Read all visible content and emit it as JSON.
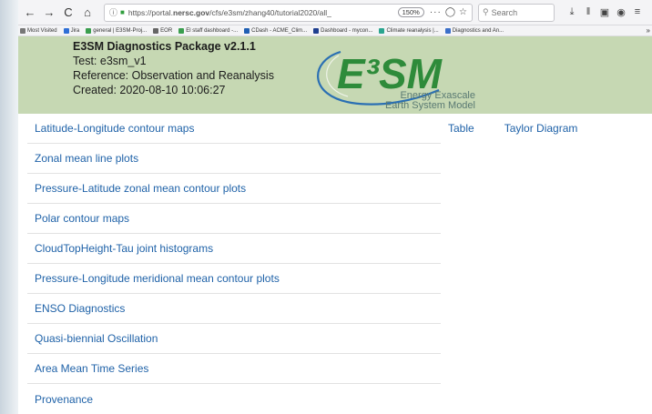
{
  "browser": {
    "nav": {
      "back": "←",
      "forward": "→",
      "reload": "C",
      "home": "⌂"
    },
    "url_prefix": "https://portal.",
    "url_domain": "nersc.gov",
    "url_path": "/cfs/e3sm/zhang40/tutorial2020/all_",
    "zoom": "150%",
    "page_actions": "···",
    "search_placeholder": "Search",
    "bookmarks": [
      {
        "label": "Most Visited",
        "color": "#777777"
      },
      {
        "label": "Jira",
        "color": "#2f6fd6"
      },
      {
        "label": "general | E3SM-Proj...",
        "color": "#3a9e4e"
      },
      {
        "label": "EOR",
        "color": "#666666"
      },
      {
        "label": "El staff dashboard -...",
        "color": "#3a9e4e"
      },
      {
        "label": "CDash - ACME_Clim...",
        "color": "#1f5fb3"
      },
      {
        "label": "Dashboard - mycon...",
        "color": "#1f3f8f"
      },
      {
        "label": "Climate reanalysis |...",
        "color": "#2aa58f"
      },
      {
        "label": "Diagnostics and An...",
        "color": "#3b6fc9"
      }
    ],
    "bookmarks_more": "»"
  },
  "header": {
    "title": "E3SM Diagnostics Package v2.1.1",
    "test": "Test: e3sm_v1",
    "reference": "Reference: Observation and Reanalysis",
    "created": "Created: 2020-08-10 10:06:27",
    "logo_text": "E³SM",
    "logo_sub1": "Energy Exascale",
    "logo_sub2": "Earth System Model"
  },
  "menu": [
    "Latitude-Longitude contour maps",
    "Zonal mean line plots",
    "Pressure-Latitude zonal mean contour plots",
    "Polar contour maps",
    "CloudTopHeight-Tau joint histograms",
    "Pressure-Longitude meridional mean contour plots",
    "ENSO Diagnostics",
    "Quasi-biennial Oscillation",
    "Area Mean Time Series",
    "Provenance"
  ],
  "side_links": {
    "table": "Table",
    "taylor": "Taylor Diagram"
  },
  "colors": {
    "header_bg": "#c6d8b3",
    "link": "#1f62a8",
    "logo_green": "#2e8b3a",
    "logo_blue": "#2a6fb3"
  }
}
